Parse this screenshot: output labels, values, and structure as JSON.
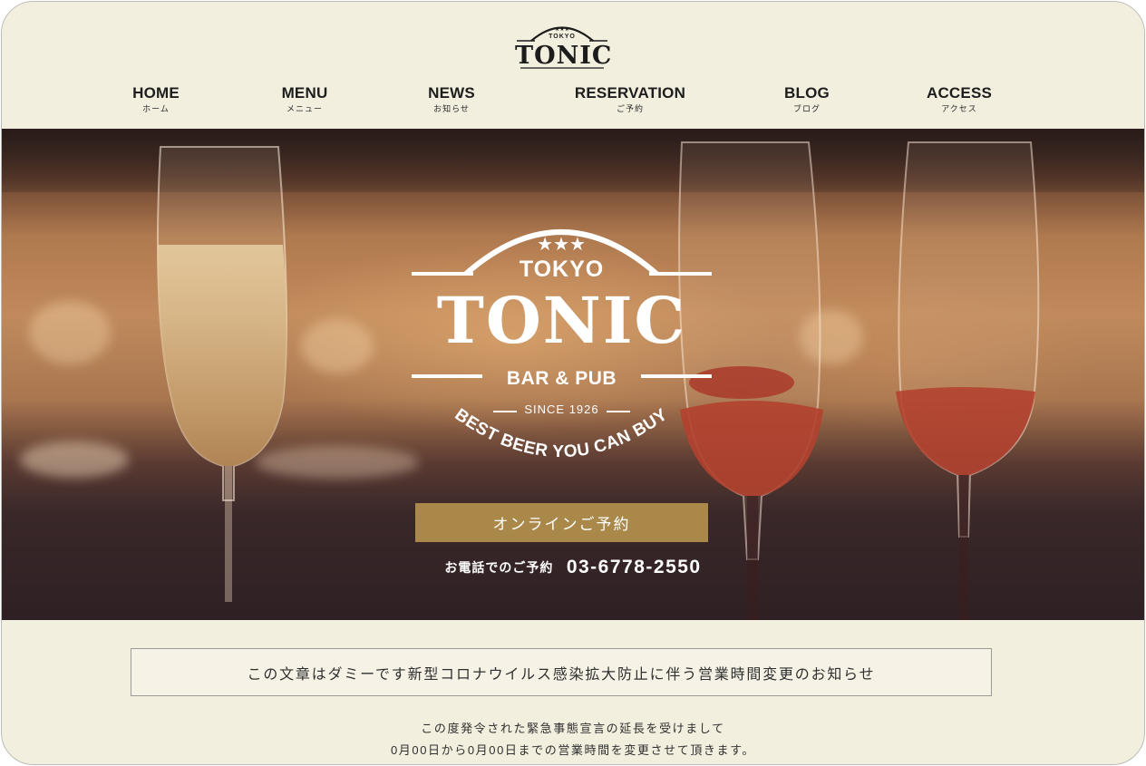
{
  "header": {
    "logo": {
      "top_text": "TOKYO",
      "name": "TONIC"
    },
    "nav": [
      {
        "en": "HOME",
        "jp": "ホーム"
      },
      {
        "en": "MENU",
        "jp": "メニュー"
      },
      {
        "en": "NEWS",
        "jp": "お知らせ"
      },
      {
        "en": "RESERVATION",
        "jp": "ご予約"
      },
      {
        "en": "BLOG",
        "jp": "ブログ"
      },
      {
        "en": "ACCESS",
        "jp": "アクセス"
      }
    ]
  },
  "hero": {
    "logo": {
      "city": "TOKYO",
      "name": "TONIC",
      "subtitle": "BAR & PUB",
      "since": "SINCE 1926",
      "tagline": "BEST BEER YOU CAN BUY"
    },
    "reserve_button": "オンラインご予約",
    "phone_label": "お電話でのご予約",
    "phone_number": "03-6778-2550"
  },
  "notice": {
    "title": "この文章はダミーです新型コロナウイルス感染拡大防止に伴う営業時間変更のお知らせ",
    "lines": [
      "この度発令された緊急事態宣言の延長を受けまして",
      "0月00日から0月00日までの営業時間を変更させて頂きます。"
    ]
  },
  "colors": {
    "background": "#f3efdf",
    "accent_gold": "#a9884a",
    "text_dark": "#1d1d1d"
  }
}
